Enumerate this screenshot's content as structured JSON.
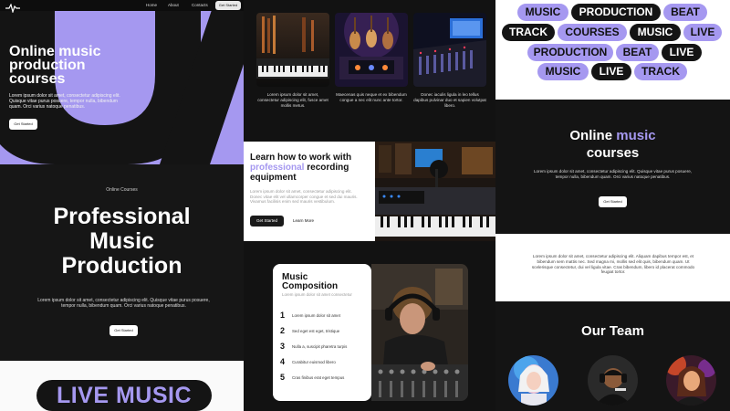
{
  "nav": {
    "links": [
      "Home",
      "About",
      "Contacts"
    ],
    "cta": "Get Started"
  },
  "hero1": {
    "title": "Online music production courses",
    "body": "Lorem ipsum dolor sit amet, consectetur adipiscing elit. Quisque vitae purus posuere, tempor nulla, bibendum quam. Orci varius natoque penatibus.",
    "button": "Get Started"
  },
  "pro": {
    "eyebrow": "Online Courses",
    "title": "Professional Music Production",
    "body": "Lorem ipsum dolor sit amet, consectetur adipiscing elit. Quisque vitae purus posuere, tempor nulla, bibendum quam. Orci varius natoque penatibus.",
    "button": "Get Started"
  },
  "live_music": "LIVE MUSIC",
  "gallery": [
    {
      "caption": "Lorem ipsum dolor sit amet, consectetur adipiscing elit, fusce amet mollis metus."
    },
    {
      "caption": "Maecenas quis neque et ex bibendum congue a nec elit nunc ante tortor."
    },
    {
      "caption": "Donec iaculis ligula in leo tellus dapibus pulvinar duo et sapien volutpat libero."
    }
  ],
  "learn": {
    "title_pre": "Learn how to work with",
    "title_accent": "professional",
    "title_post": "recording equipment",
    "body": "Lorem ipsum dolor sit amet, consectetur adipiscing elit. Donec vitae elit vel ullamcorper congue et sed dui mauris. Vivamus facilisis enim sed mauris vestibulum.",
    "button": "Get Started",
    "link": "Learn More"
  },
  "composition": {
    "title": "Music Composition",
    "subtitle": "Lorem ipsum dolor sit amet consectetur",
    "steps": [
      {
        "num": "1",
        "text": "Lorem ipsum dolor sit amet"
      },
      {
        "num": "2",
        "text": "Sed eget est eget, tristique"
      },
      {
        "num": "3",
        "text": "Nulla a, suscipit pharetra turpis"
      },
      {
        "num": "4",
        "text": "Curabitur euismod libero"
      },
      {
        "num": "5",
        "text": "Cras finibus erat eget tempus"
      }
    ]
  },
  "tags": [
    "MUSIC",
    "PRODUCTION",
    "BEAT",
    "TRACK",
    "COURSES",
    "MUSIC",
    "LIVE",
    "PRODUCTION",
    "BEAT",
    "LIVE",
    "MUSIC",
    "LIVE",
    "TRACK"
  ],
  "online_courses": {
    "title_pre": "Online",
    "title_accent": "music",
    "title_post": "courses",
    "body": "Lorem ipsum dolor sit amet, consectetur adipiscing elit. Quisque vitae purus posuere, tempor nulla, bibendum quam. Orci varius natoque penatibus.",
    "button": "Get Started"
  },
  "lorem_block": {
    "body": "Lorem ipsum dolor sit amet, consectetur adipiscing elit. Aliquam dapibus tempor est, et bibendum sem mattis nec. Sed magna mi, mollis sed elit quis, bibendum quam. Ut scelerisque consectetur, dui vel ligula vitae. Cras bibendum, libero id placerat commodo feugiat tortor."
  },
  "team": {
    "title": "Our Team"
  },
  "colors": {
    "accent": "#a598f0",
    "dark": "#141414",
    "light": "#ffffff"
  }
}
